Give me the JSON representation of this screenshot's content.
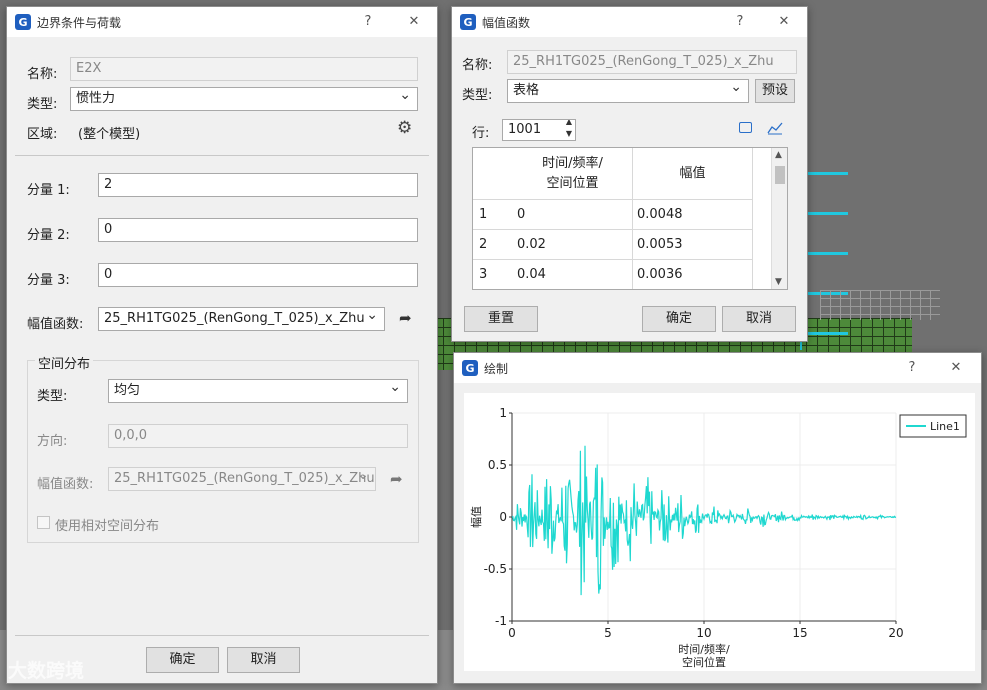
{
  "boundary_dialog": {
    "title": "边界条件与荷载",
    "help": "?",
    "close": "✕",
    "name_label": "名称:",
    "name_value": "E2X",
    "type_label": "类型:",
    "type_value": "惯性力",
    "region_label": "区域:",
    "region_value": "(整个模型)",
    "comp1_label": "分量 1:",
    "comp1_value": "2",
    "comp2_label": "分量 2:",
    "comp2_value": "0",
    "comp3_label": "分量 3:",
    "comp3_value": "0",
    "amp_label": "幅值函数:",
    "amp_value": "25_RH1TG025_(RenGong_T_025)_x_Zhu",
    "spatial_group": "空间分布",
    "sp_type_label": "类型:",
    "sp_type_value": "均匀",
    "sp_dir_label": "方向:",
    "sp_dir_value": "0,0,0",
    "sp_amp_label": "幅值函数:",
    "sp_amp_value": "25_RH1TG025_(RenGong_T_025)_x_Zhu",
    "relative_label": "使用相对空间分布",
    "ok": "确定",
    "cancel": "取消"
  },
  "amp_dialog": {
    "title": "幅值函数",
    "help": "?",
    "close": "✕",
    "name_label": "名称:",
    "name_value": "25_RH1TG025_(RenGong_T_025)_x_Zhu",
    "type_label": "类型:",
    "type_value": "表格",
    "preset": "预设",
    "rows_label": "行:",
    "rows_value": "1001",
    "col_time": "时间/频率/\n空间位置",
    "col_amp": "幅值",
    "rows": [
      {
        "n": "1",
        "t": "0",
        "a": "0.0048"
      },
      {
        "n": "2",
        "t": "0.02",
        "a": "0.0053"
      },
      {
        "n": "3",
        "t": "0.04",
        "a": "0.0036"
      }
    ],
    "reset": "重置",
    "ok": "确定",
    "cancel": "取消"
  },
  "plot_dialog": {
    "title": "绘制",
    "help": "?",
    "close": "✕"
  },
  "chart_data": {
    "type": "line",
    "series": [
      {
        "name": "Line1",
        "color": "#1fd8d0"
      }
    ],
    "xlabel": "时间/频率/\n空间位置",
    "ylabel": "幅值",
    "xlim": [
      0,
      20
    ],
    "ylim": [
      -1,
      1
    ],
    "xticks": [
      "0",
      "5",
      "10",
      "15",
      "20"
    ],
    "yticks": [
      "1",
      "0.5",
      "0",
      "-0.5",
      "-1"
    ],
    "envelope": [
      [
        0,
        0.0048
      ],
      [
        0.5,
        0.3
      ],
      [
        1.0,
        0.45
      ],
      [
        1.5,
        0.55
      ],
      [
        2.0,
        0.6
      ],
      [
        2.5,
        0.65
      ],
      [
        3.0,
        0.6
      ],
      [
        3.5,
        0.75
      ],
      [
        4.0,
        0.95
      ],
      [
        4.5,
        0.8
      ],
      [
        5.0,
        0.7
      ],
      [
        5.5,
        0.55
      ],
      [
        6.0,
        0.5
      ],
      [
        6.5,
        0.45
      ],
      [
        7.0,
        0.4
      ],
      [
        7.5,
        0.35
      ],
      [
        8.0,
        0.35
      ],
      [
        8.5,
        0.3
      ],
      [
        9.0,
        0.25
      ],
      [
        9.5,
        0.2
      ],
      [
        10.0,
        0.12
      ],
      [
        11.0,
        0.1
      ],
      [
        12.0,
        0.08
      ],
      [
        13.0,
        0.1
      ],
      [
        14.0,
        0.06
      ],
      [
        15.0,
        0.04
      ],
      [
        16.0,
        0.03
      ],
      [
        17.0,
        0.03
      ],
      [
        18.0,
        0.025
      ],
      [
        19.0,
        0.02
      ],
      [
        20.0,
        0.01
      ]
    ],
    "legend": "top-right"
  },
  "watermark": "大数跨境"
}
